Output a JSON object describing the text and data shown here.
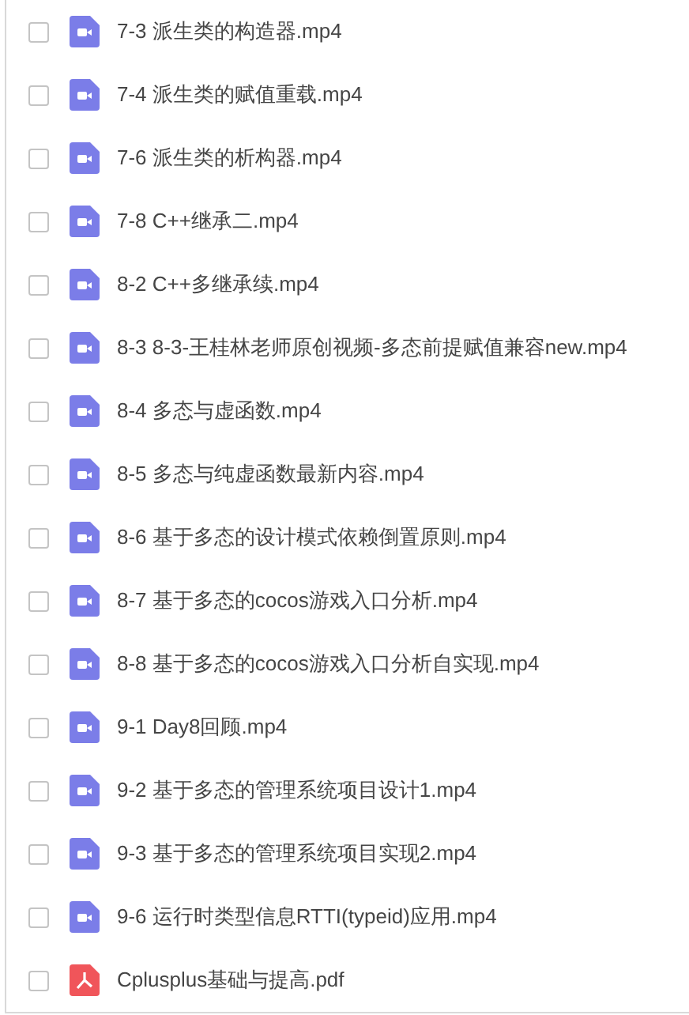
{
  "files": [
    {
      "name": "7-3 派生类的构造器.mp4",
      "kind": "video",
      "checked": false
    },
    {
      "name": "7-4 派生类的赋值重载.mp4",
      "kind": "video",
      "checked": false
    },
    {
      "name": "7-6 派生类的析构器.mp4",
      "kind": "video",
      "checked": false
    },
    {
      "name": "7-8 C++继承二.mp4",
      "kind": "video",
      "checked": false
    },
    {
      "name": "8-2 C++多继承续.mp4",
      "kind": "video",
      "checked": false
    },
    {
      "name": "8-3 8-3-王桂林老师原创视频-多态前提赋值兼容new.mp4",
      "kind": "video",
      "checked": false
    },
    {
      "name": "8-4 多态与虚函数.mp4",
      "kind": "video",
      "checked": false
    },
    {
      "name": "8-5 多态与纯虚函数最新内容.mp4",
      "kind": "video",
      "checked": false
    },
    {
      "name": "8-6 基于多态的设计模式依赖倒置原则.mp4",
      "kind": "video",
      "checked": false
    },
    {
      "name": "8-7 基于多态的cocos游戏入口分析.mp4",
      "kind": "video",
      "checked": false
    },
    {
      "name": "8-8 基于多态的cocos游戏入口分析自实现.mp4",
      "kind": "video",
      "checked": false
    },
    {
      "name": "9-1 Day8回顾.mp4",
      "kind": "video",
      "checked": false
    },
    {
      "name": "9-2 基于多态的管理系统项目设计1.mp4",
      "kind": "video",
      "checked": false
    },
    {
      "name": "9-3 基于多态的管理系统项目实现2.mp4",
      "kind": "video",
      "checked": false
    },
    {
      "name": "9-6 运行时类型信息RTTI(typeid)应用.mp4",
      "kind": "video",
      "checked": false
    },
    {
      "name": "Cplusplus基础与提高.pdf",
      "kind": "pdf",
      "checked": false
    }
  ]
}
